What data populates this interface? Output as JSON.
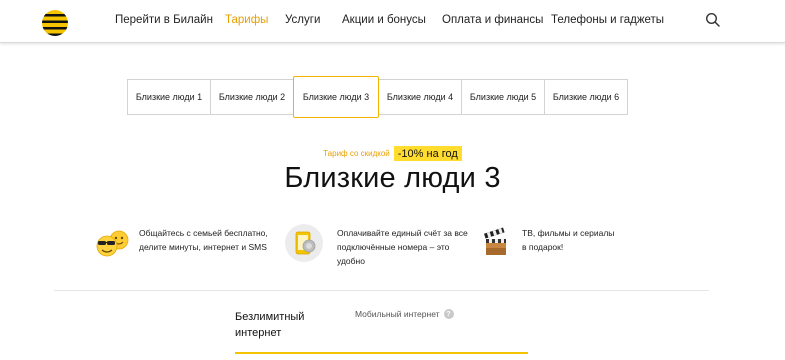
{
  "nav": {
    "items": [
      {
        "label": "Перейти в Билайн",
        "active": false
      },
      {
        "label": "Тарифы",
        "active": true
      },
      {
        "label": "Услуги",
        "active": false
      },
      {
        "label": "Акции и бонусы",
        "active": false
      },
      {
        "label": "Оплата и финансы",
        "active": false
      },
      {
        "label": "Телефоны и гаджеты",
        "active": false
      }
    ]
  },
  "tabs": [
    {
      "label": "Близкие люди 1",
      "active": false
    },
    {
      "label": "Близкие люди 2",
      "active": false
    },
    {
      "label": "Близкие люди 3",
      "active": true
    },
    {
      "label": "Близкие люди 4",
      "active": false
    },
    {
      "label": "Близкие люди 5",
      "active": false
    },
    {
      "label": "Близкие люди 6",
      "active": false
    }
  ],
  "promo": {
    "label": "Тариф со скидкой",
    "badge": "-10% на год"
  },
  "title": "Близкие люди 3",
  "features": [
    {
      "icon": "family-emoji-icon",
      "line1": "Общайтесь с семьей бесплатно,",
      "line2": "делите минуты, интернет и SMS",
      "line3": ""
    },
    {
      "icon": "phone-bill-icon",
      "line1": "Оплачивайте единый счёт за все",
      "line2": "подключённые номера – это",
      "line3": "удобно"
    },
    {
      "icon": "clapperboard-icon",
      "line1": "ТВ, фильмы и сериалы",
      "line2": "в подарок!",
      "line3": ""
    }
  ],
  "details": {
    "unlimited_line1": "Безлимитный",
    "unlimited_line2": "интернет",
    "mobile_internet": "Мобильный интернет",
    "help_symbol": "?"
  },
  "colors": {
    "accent": "#f5c400",
    "active_text": "#e8a000",
    "badge_bg": "#ffdc2e"
  }
}
